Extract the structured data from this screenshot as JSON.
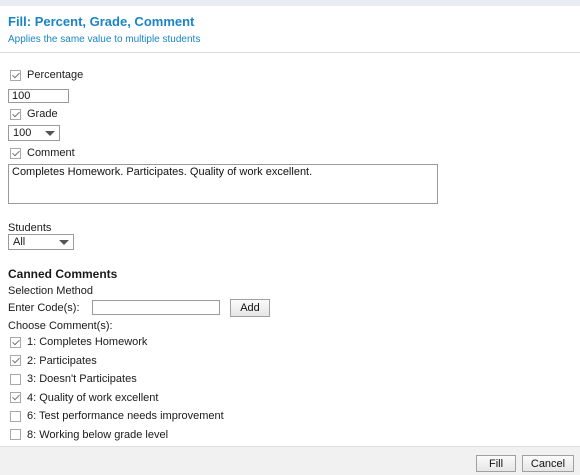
{
  "header": {
    "title": "Fill: Percent, Grade, Comment",
    "subtitle": "Applies the same value to multiple students"
  },
  "form": {
    "percentage": {
      "label": "Percentage",
      "checked": true,
      "value": "100"
    },
    "grade": {
      "label": "Grade",
      "checked": true,
      "value": "100"
    },
    "comment": {
      "label": "Comment",
      "checked": true,
      "value": "Completes Homework. Participates. Quality of work excellent."
    },
    "students": {
      "label": "Students",
      "value": "All"
    }
  },
  "canned": {
    "title": "Canned Comments",
    "selection_method": "Selection Method",
    "enter_code_label": "Enter Code(s):",
    "code_value": "",
    "add_label": "Add",
    "choose_label": "Choose Comment(s):",
    "items": [
      {
        "label": "1: Completes Homework",
        "checked": true
      },
      {
        "label": "2: Participates",
        "checked": true
      },
      {
        "label": "3: Doesn't Participates",
        "checked": false
      },
      {
        "label": "4: Quality of work excellent",
        "checked": true
      },
      {
        "label": "6: Test performance needs improvement",
        "checked": false
      },
      {
        "label": "8: Working below grade level",
        "checked": false
      }
    ]
  },
  "footer": {
    "fill_label": "Fill",
    "cancel_label": "Cancel"
  }
}
